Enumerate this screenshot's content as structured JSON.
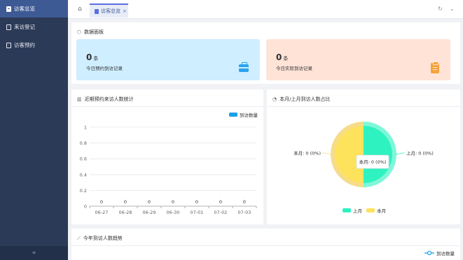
{
  "sidebar": {
    "items": [
      {
        "label": "访客总览",
        "active": true
      },
      {
        "label": "来访登记",
        "active": false
      },
      {
        "label": "访客预约",
        "active": false
      }
    ],
    "collapse_icon": "«"
  },
  "tabs": {
    "home_icon": "⌂",
    "active_tab": "访客总览",
    "close_icon": "×",
    "refresh_icon": "↻",
    "more_icon": "⌄"
  },
  "panel": {
    "title": "数据面板",
    "stats": [
      {
        "value": "0",
        "unit": "条",
        "desc": "今日预约到访记录",
        "icon": "briefcase-icon",
        "color": "#2aa3ef"
      },
      {
        "value": "0",
        "unit": "条",
        "desc": "今日实际到访记录",
        "icon": "clipboard-icon",
        "color": "#f5a33b"
      }
    ]
  },
  "colors": {
    "accent": "#5b6ee0",
    "bar": "#1aa0e8",
    "current_month": "#fde25c",
    "last_month": "#2ef2c0"
  },
  "chart_data": [
    {
      "type": "bar",
      "title": "近期预约来访人数统计",
      "categories": [
        "06-27",
        "06-28",
        "06-29",
        "06-30",
        "07-01",
        "07-02",
        "07-03"
      ],
      "series": [
        {
          "name": "到访数量",
          "values": [
            0,
            0,
            0,
            0,
            0,
            0,
            0
          ]
        }
      ],
      "ylim": [
        0,
        1
      ],
      "yticks": [
        "0",
        "0.2",
        "0.4",
        "0.6",
        "0.8",
        "1"
      ],
      "data_labels": [
        "0",
        "0",
        "0",
        "0",
        "0",
        "0",
        "0"
      ],
      "legend": "top-right"
    },
    {
      "type": "pie",
      "title": "本月/上月到访人数占比",
      "slices": [
        {
          "name": "上月",
          "value": 0,
          "label": "上月: 0 (0%)"
        },
        {
          "name": "本月",
          "value": 0,
          "label": "本月: 0 (0%)"
        }
      ],
      "tooltip": "本月: 0 (0%)",
      "legend": "bottom"
    },
    {
      "type": "line",
      "title": "今年到访人数趋势",
      "series": [
        {
          "name": "到访数量"
        }
      ],
      "legend": "top-right"
    }
  ]
}
